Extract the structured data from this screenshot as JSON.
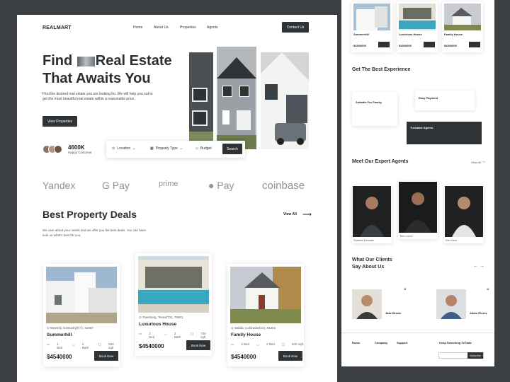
{
  "brand": "REALMART",
  "nav": {
    "home": "Home",
    "about": "About Us",
    "properties": "Properties",
    "agents": "Agents",
    "contact": "Contact Us"
  },
  "hero": {
    "line1a": "Find",
    "line1b": "Real Estate",
    "line2": "That Awaits You",
    "lead": "Find the desired real estate you are looking for. We will help you out to get the most beautiful real estate within a reasonable price.",
    "cta": "View Properties",
    "count": "4600K",
    "count_label": "Happy Customer"
  },
  "search": {
    "location": "Location",
    "type": "Property Type",
    "budget": "Budget",
    "button": "Search"
  },
  "partners": [
    "Yandex",
    "G Pay",
    "prime",
    "Pay",
    "coinbase"
  ],
  "deals": {
    "title": "Best Property Deals",
    "view_all": "View All",
    "sub": "We care about your needs and we offer you the best deals. You can have look on what's best for you."
  },
  "cards": [
    {
      "location": "Waverly, Kentucky(KY), 42467",
      "name": "Summerhill",
      "bed": "1 Bed",
      "bath": "2 Bath",
      "area": "650 sqft",
      "price": "$4540000",
      "book": "Book Now"
    },
    {
      "location": "Townburg, Texas(TX), 75501",
      "name": "Luxurious House",
      "bed": "2 Bed",
      "bath": "3 Bath",
      "area": "700 sqft",
      "price": "$4540000",
      "book": "Book Now"
    },
    {
      "location": "Salida, Colorado(CO), 81201",
      "name": "Family House",
      "bed": "3 Bed",
      "bath": "2 Bed",
      "area": "500 sqft",
      "price": "$4540000",
      "book": "Book Now"
    }
  ],
  "side": {
    "mini": [
      {
        "name": "Summerhill",
        "price": "$4540000"
      },
      {
        "name": "Luxurious House",
        "price": "$4540000"
      },
      {
        "name": "Family House",
        "price": "$4540000"
      }
    ],
    "experience_title": "Get The Best Experience",
    "exp": [
      {
        "title": "Suitable For Family"
      },
      {
        "title": "Easy Payment"
      },
      {
        "title": "Trustable Agents"
      }
    ],
    "agents_title": "Meet Our Expert Agents",
    "view_all": "View All",
    "agent_names": [
      "Shahed Hossain",
      "Tom Loren",
      "Dev Dew"
    ],
    "clients_title": "What Our Clients Say About Us",
    "client_names": [
      "Jake Brown",
      "Adam Rivers"
    ],
    "footer": [
      "Home",
      "Company",
      "Support",
      "Keep Searching To Date"
    ],
    "subscribe": "Subscribe"
  }
}
